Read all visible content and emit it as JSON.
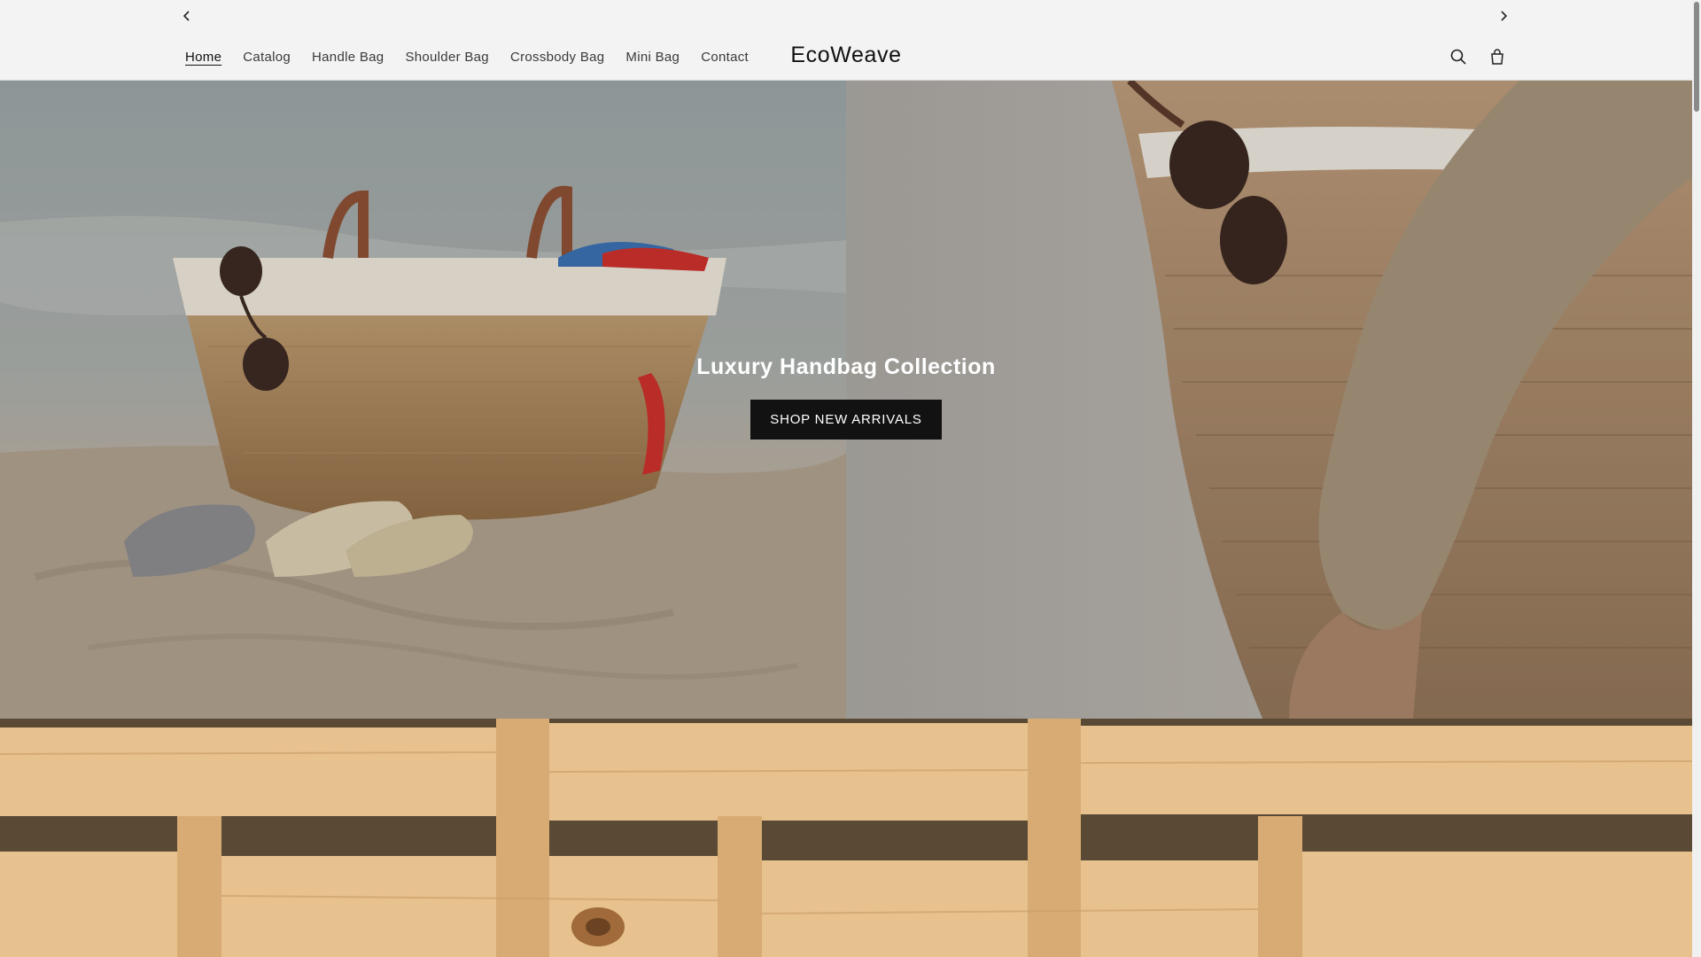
{
  "announcement": {
    "prev_icon": "chevron-left-icon",
    "next_icon": "chevron-right-icon"
  },
  "header": {
    "nav": [
      {
        "label": "Home",
        "active": true
      },
      {
        "label": "Catalog",
        "active": false
      },
      {
        "label": "Handle Bag",
        "active": false
      },
      {
        "label": "Shoulder Bag",
        "active": false
      },
      {
        "label": "Crossbody Bag",
        "active": false
      },
      {
        "label": "Mini Bag",
        "active": false
      },
      {
        "label": "Contact",
        "active": false
      }
    ],
    "brand": "EcoWeave",
    "icons": [
      "search-icon",
      "cart-icon"
    ]
  },
  "hero": {
    "title": "Luxury Handbag Collection",
    "button_label": "SHOP NEW ARRIVALS"
  },
  "colors": {
    "header_bg": "#f3f3f3",
    "button_bg": "#121212",
    "text": "#111111"
  }
}
